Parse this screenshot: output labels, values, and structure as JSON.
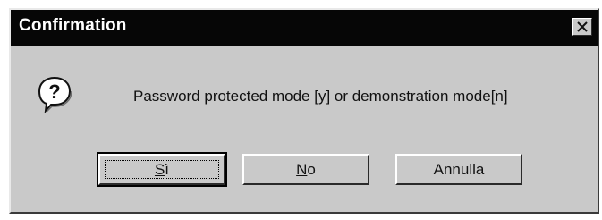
{
  "window": {
    "title": "Confirmation",
    "close_icon": "close-icon"
  },
  "message": {
    "icon": "question-icon",
    "text": "Password protected mode [y] or demonstration mode[n]"
  },
  "buttons": {
    "yes": {
      "accel": "S",
      "rest": "ì",
      "is_default": true
    },
    "no": {
      "accel": "N",
      "rest": "o"
    },
    "cancel": {
      "label": "Annulla"
    }
  },
  "colors": {
    "title_bar": "#060606",
    "dialog_face": "#c9c9c9",
    "title_text": "#ffffff"
  }
}
